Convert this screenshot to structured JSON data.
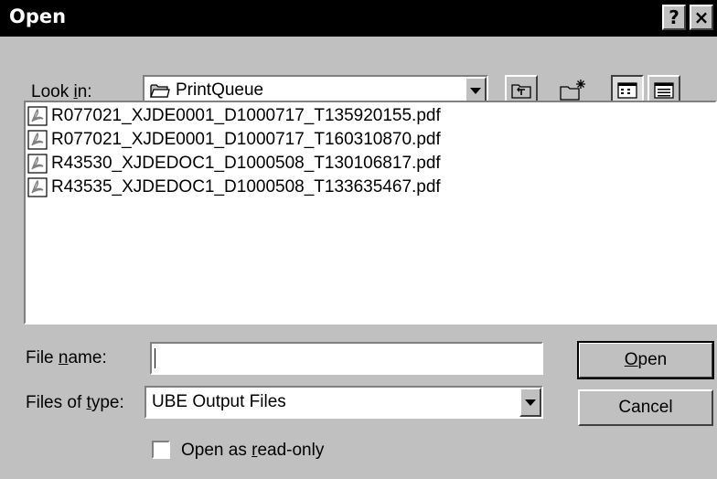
{
  "window": {
    "title": "Open",
    "help_glyph": "?",
    "close_glyph": "×"
  },
  "look_in": {
    "label_pre": "Look ",
    "label_accel": "i",
    "label_post": "n:",
    "value": "PrintQueue"
  },
  "toolbar": {
    "icons": [
      "up-one-level-icon",
      "create-new-folder-icon",
      "list-view-icon",
      "details-view-icon"
    ]
  },
  "files": [
    {
      "name": "R077021_XJDE0001_D1000717_T135920155.pdf",
      "icon": "pdf-file-icon"
    },
    {
      "name": "R077021_XJDE0001_D1000717_T160310870.pdf",
      "icon": "pdf-file-icon"
    },
    {
      "name": "R43530_XJDEDOC1_D1000508_T130106817.pdf",
      "icon": "pdf-file-icon"
    },
    {
      "name": "R43535_XJDEDOC1_D1000508_T133635467.pdf",
      "icon": "pdf-file-icon"
    }
  ],
  "file_name": {
    "label_pre": "File ",
    "label_accel": "n",
    "label_post": "ame:",
    "value": ""
  },
  "file_type": {
    "label_pre": "Files of ",
    "label_accel": "t",
    "label_post": "ype:",
    "value": "UBE Output Files"
  },
  "buttons": {
    "open_accel": "O",
    "open_rest": "pen",
    "cancel": "Cancel"
  },
  "read_only": {
    "label_pre": "Open as ",
    "label_accel": "r",
    "label_post": "ead-only",
    "checked": false
  }
}
